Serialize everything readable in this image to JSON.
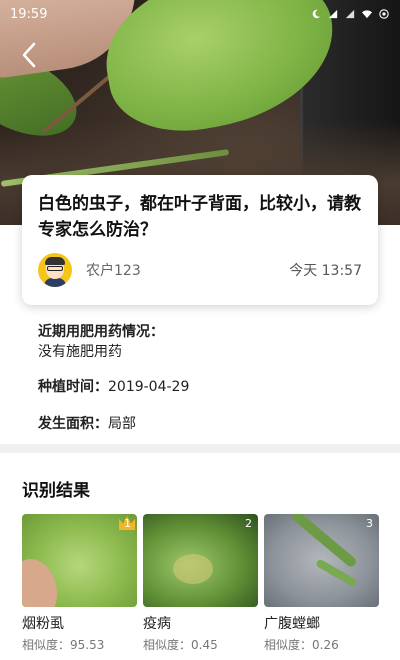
{
  "status_bar": {
    "time": "19:59",
    "icons": [
      "moon-icon",
      "signal-icon",
      "signal-icon",
      "wifi-icon",
      "battery-icon"
    ]
  },
  "question": {
    "text": "白色的虫子，都在叶子背面，比较小，请教专家怎么防治？",
    "user": "农户123",
    "date": "今天 13:57"
  },
  "details": {
    "fertilizer_label": "近期用肥用药情况：",
    "fertilizer_value": "没有施肥用药",
    "planting_label": "种植时间：",
    "planting_value": "2019-04-29",
    "area_label": "发生面积：",
    "area_value": "局部"
  },
  "results": {
    "title": "识别结果",
    "items": [
      {
        "rank": "1",
        "name": "烟粉虱",
        "similarity": "相似度：95.53"
      },
      {
        "rank": "2",
        "name": "疫病",
        "similarity": "相似度：0.45"
      },
      {
        "rank": "3",
        "name": "广腹螳螂",
        "similarity": "相似度：0.26"
      }
    ]
  },
  "colors": {
    "accent_yellow": "#f5c518",
    "divider": "#f0f0f0"
  }
}
